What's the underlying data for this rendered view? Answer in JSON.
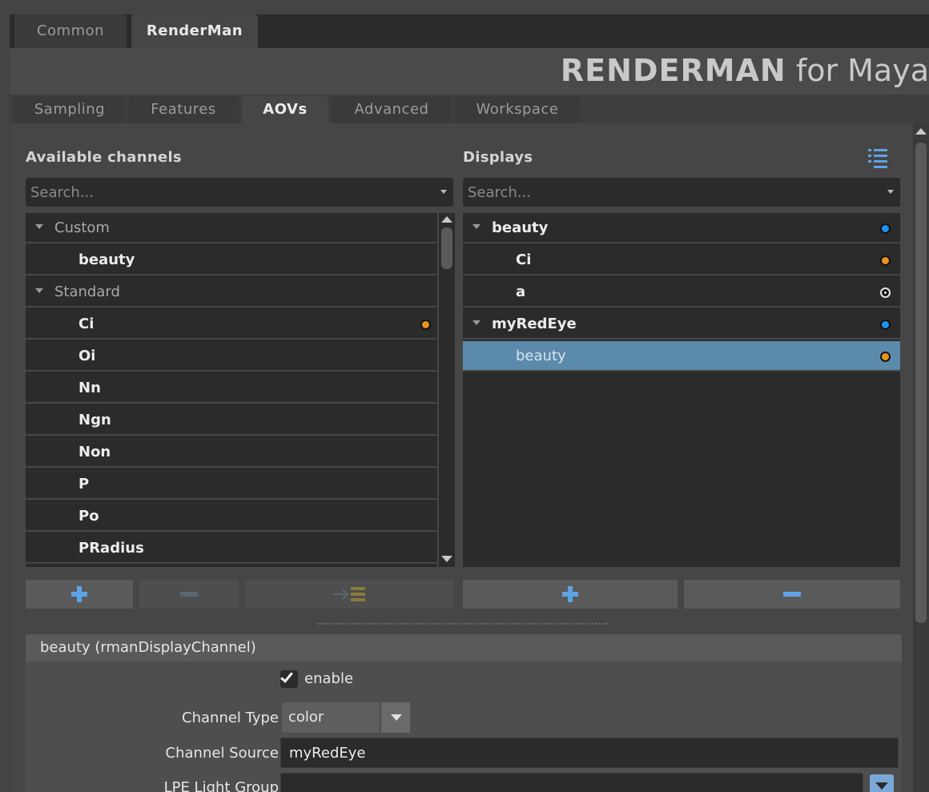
{
  "top_tabs": {
    "common": "Common",
    "renderman": "RenderMan"
  },
  "banner": {
    "brand": "RENDERMAN",
    "suffix": " for Maya"
  },
  "sub_tabs": {
    "sampling": "Sampling",
    "features": "Features",
    "aovs": "AOVs",
    "advanced": "Advanced",
    "workspace": "Workspace"
  },
  "available": {
    "label": "Available channels",
    "search_placeholder": "Search...",
    "rows": [
      {
        "text": "Custom",
        "type": "group"
      },
      {
        "text": "beauty",
        "type": "item"
      },
      {
        "text": "Standard",
        "type": "group"
      },
      {
        "text": "Ci",
        "type": "item",
        "dot": "orange"
      },
      {
        "text": "Oi",
        "type": "item"
      },
      {
        "text": "Nn",
        "type": "item"
      },
      {
        "text": "Ngn",
        "type": "item"
      },
      {
        "text": "Non",
        "type": "item"
      },
      {
        "text": "P",
        "type": "item"
      },
      {
        "text": "Po",
        "type": "item"
      },
      {
        "text": "PRadius",
        "type": "item"
      }
    ]
  },
  "displays": {
    "label": "Displays",
    "search_placeholder": "Search...",
    "rows": [
      {
        "text": "beauty",
        "type": "group",
        "dot": "blue"
      },
      {
        "text": "Ci",
        "type": "item",
        "dot": "orange"
      },
      {
        "text": "a",
        "type": "item",
        "dot": "white"
      },
      {
        "text": "myRedEye",
        "type": "group",
        "dot": "blue"
      },
      {
        "text": "beauty",
        "type": "item",
        "dot": "orange",
        "selected": true
      }
    ]
  },
  "attr": {
    "header": "beauty  (rmanDisplayChannel)",
    "enable_label": "enable",
    "enable_checked": true,
    "channel_type_label": "Channel Type",
    "channel_type_value": "color",
    "channel_source_label": "Channel Source",
    "channel_source_value": "myRedEye",
    "lpe_label": "LPE Light Group",
    "lpe_value": ""
  }
}
